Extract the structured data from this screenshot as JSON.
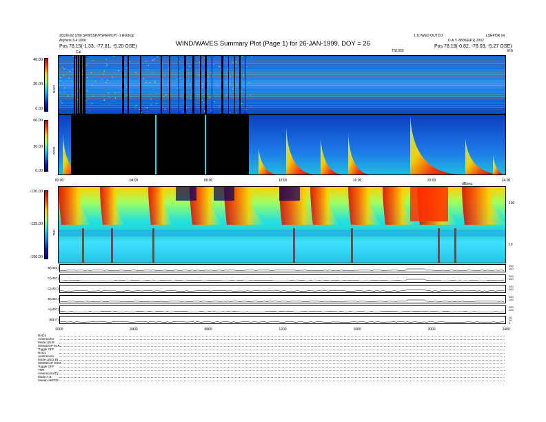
{
  "header": {
    "left_line1": "20100-02 (200 SPWSSP/PSPER/CP) -1 Roldrop",
    "left_line2": "Aliyhers 3.4 1000",
    "left_line3": "Pos   78.15(-1.33, -77.81, -5.20 GSE)",
    "right_line1": "1:10 WED OUTCO",
    "right_line2": "D.A.Y. 8800(RP1) 2002",
    "right_line3": "Pos   78.19(-0.82, -78.03, -5.27 GSE)",
    "corner_right": "LSEPOR ret",
    "title": "WIND/WAVES Summary Plot (Page 1) for 26-JAN-1999, DOY = 26",
    "marker_cal": "Cal",
    "marker_top_right": "TS1050",
    "marker_khz": "kHz"
  },
  "rad2": {
    "yticks": [
      "40.00",
      "20.00",
      "0.00"
    ],
    "label": "RAD2"
  },
  "rad1": {
    "yticks": [
      "60.00",
      "30.00",
      "0.00"
    ],
    "label": "RAD1"
  },
  "tnr": {
    "yticks": [
      "-120.00",
      "-135.00",
      "-150.00"
    ],
    "label": "TNR",
    "right_ticks": [
      "100",
      "10"
    ],
    "corner": "dB/sec"
  },
  "xticks": [
    "00:00",
    "04:00",
    "08:00",
    "12:00",
    "16:00",
    "20:00",
    "24:00"
  ],
  "strips": [
    {
      "label": "B(ADC)",
      "ticks": [
        "200",
        "100"
      ]
    },
    {
      "label": "C(ADC)",
      "ticks": [
        "200",
        "100"
      ]
    },
    {
      "label": "C(ADC)",
      "ticks": [
        "200",
        "100"
      ]
    },
    {
      "label": "B(ADC)",
      "ticks": [
        "200",
        "100"
      ]
    },
    {
      "label": "A(ADC)",
      "ticks": [
        "200",
        "100"
      ]
    },
    {
      "label": "|B|(nT)",
      "ticks": [
        "15",
        "10",
        "5"
      ]
    }
  ],
  "xticks_bottom": [
    "0000",
    "0400",
    "0800",
    "1200",
    "1600",
    "2000",
    "2400"
  ],
  "footer": [
    "RAD2",
    "Antenna    Ex",
    "Mode    LIN B",
    "S/MOD/AP  ELP",
    "Toggle     OFF",
    "RAD1",
    "Antenna    Ex",
    "Mode  LIN(2,B)",
    "S/MOD/AP SUM",
    "Toggle     OFF",
    "TNR",
    "Antenna   Ex/Ey",
    "Mode         A,B",
    "Sweep  ABCDE"
  ],
  "chart_data": [
    {
      "type": "heatmap",
      "title": "RAD2",
      "ylabel": "RAD2",
      "ylim": [
        0,
        40
      ],
      "xlim": [
        "00:00",
        "24:00"
      ],
      "colorscale": [
        "#000080",
        "#0020c0",
        "#0090ff",
        "#20e0e0",
        "#a0ff60",
        "#ffd000",
        "#ff5000",
        "#d40000"
      ]
    },
    {
      "type": "heatmap",
      "title": "RAD1",
      "ylabel": "RAD1",
      "ylim": [
        0,
        60
      ],
      "xlim": [
        "00:00",
        "24:00"
      ],
      "data_gap": [
        "00:50",
        "10:00"
      ]
    },
    {
      "type": "heatmap",
      "title": "TNR",
      "ylabel": "TNR",
      "ylim": [
        -150,
        -120
      ],
      "xlim": [
        "00:00",
        "24:00"
      ]
    }
  ]
}
